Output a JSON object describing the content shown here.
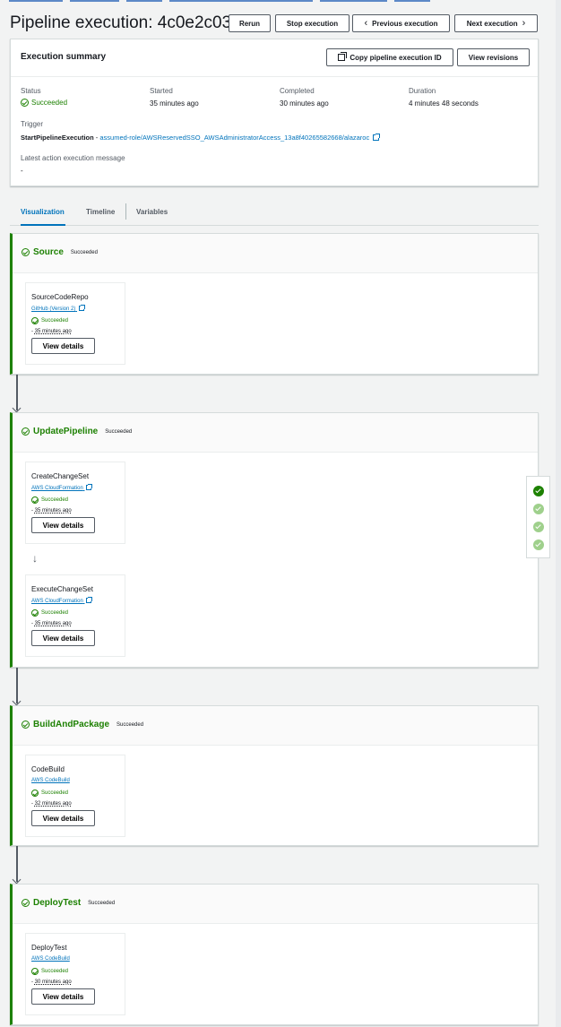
{
  "header": {
    "title": "Pipeline execution: 4c0e2c03",
    "buttons": {
      "rerun": "Rerun",
      "stop": "Stop execution",
      "previous": "Previous execution",
      "next": "Next execution"
    }
  },
  "summary": {
    "title": "Execution summary",
    "copy_button": "Copy pipeline execution ID",
    "revisions_button": "View revisions",
    "status_label": "Status",
    "status_value": "Succeeded",
    "started_label": "Started",
    "started_value": "35 minutes ago",
    "completed_label": "Completed",
    "completed_value": "30 minutes ago",
    "duration_label": "Duration",
    "duration_value": "4 minutes 48 seconds",
    "trigger_label": "Trigger",
    "trigger_name": "StartPipelineExecution",
    "trigger_separator": " - ",
    "trigger_link": "assumed-role/AWSReservedSSO_AWSAdministratorAccess_13a8f40265582668/alazaroc",
    "message_label": "Latest action execution message",
    "message_value": "-"
  },
  "tabs": [
    "Visualization",
    "Timeline",
    "Variables"
  ],
  "stages": [
    {
      "name": "Source",
      "status": "Succeeded",
      "actions": [
        {
          "name": "SourceCodeRepo",
          "provider": "GitHub (Version 2)",
          "status": "Succeeded",
          "time": "35 minutes ago",
          "button": "View details"
        }
      ]
    },
    {
      "name": "UpdatePipeline",
      "status": "Succeeded",
      "actions": [
        {
          "name": "CreateChangeSet",
          "provider": "AWS CloudFormation",
          "status": "Succeeded",
          "time": "35 minutes ago",
          "button": "View details"
        },
        {
          "name": "ExecuteChangeSet",
          "provider": "AWS CloudFormation",
          "status": "Succeeded",
          "time": "35 minutes ago",
          "button": "View details"
        }
      ]
    },
    {
      "name": "BuildAndPackage",
      "status": "Succeeded",
      "actions": [
        {
          "name": "CodeBuild",
          "provider": "AWS CodeBuild",
          "status": "Succeeded",
          "time": "32 minutes ago",
          "button": "View details"
        }
      ]
    },
    {
      "name": "DeployTest",
      "status": "Succeeded",
      "actions": [
        {
          "name": "DeployTest",
          "provider": "AWS CodeBuild",
          "status": "Succeeded",
          "time": "30 minutes ago",
          "button": "View details"
        }
      ]
    }
  ],
  "icons": {
    "status": "check-circle-icon",
    "external": "external-link-icon",
    "copy": "copy-icon",
    "arrow": "arrow-down-icon"
  },
  "colors": {
    "success": "#1d8102",
    "link": "#0073bb",
    "background": "#f2f3f3"
  },
  "time_prefix": "- "
}
